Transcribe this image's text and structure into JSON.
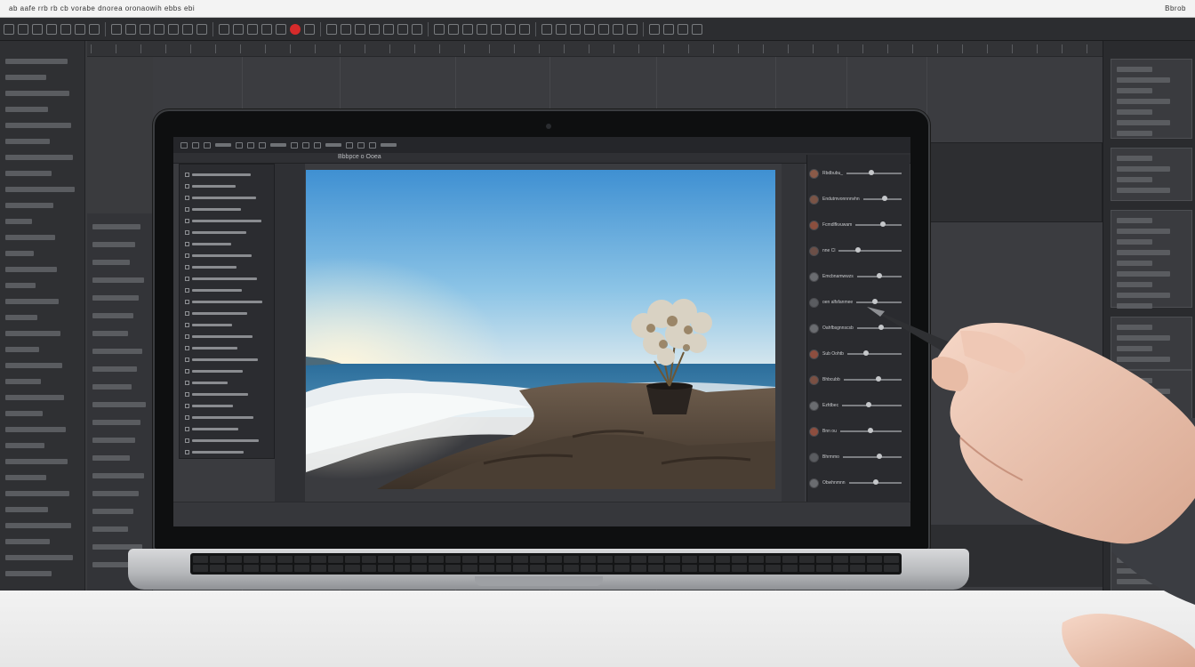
{
  "background_app": {
    "menubar_text": "ab aafe rrb rb cb vorabe dnorea oronaowih ebbs ebi",
    "menubar_right": "Bbrob",
    "tool_count": 52
  },
  "laptop_app": {
    "tab_label": "Bbbpce o Ooea",
    "photo_caption": "",
    "adjustment_rows": [
      {
        "label": "Rbdbubu_",
        "value": 0.45,
        "color": "#8a5a48"
      },
      {
        "label": "Endutmvonnnnvhn",
        "value": 0.55,
        "color": "#7a5446"
      },
      {
        "label": "Fcmdlfkvuwam",
        "value": 0.6,
        "color": "#8b4f3e"
      },
      {
        "label": "nne Cl",
        "value": 0.3,
        "color": "#6b4f47"
      },
      {
        "label": "Emcbnamwwzs",
        "value": 0.5,
        "color": "#6a6c70"
      },
      {
        "label": "oen alfsfanmee",
        "value": 0.4,
        "color": "#5a5c60"
      },
      {
        "label": "Oahfbsgnnscsb",
        "value": 0.55,
        "color": "#6a6c70"
      },
      {
        "label": "Sub Oohtb",
        "value": 0.35,
        "color": "#8d4e3f"
      },
      {
        "label": "Bhbcubb",
        "value": 0.6,
        "color": "#7a5043"
      },
      {
        "label": "Ezfdbec",
        "value": 0.45,
        "color": "#6a6c70"
      },
      {
        "label": "Bnn ou",
        "value": 0.5,
        "color": "#8d4e3f"
      },
      {
        "label": "Bhrmmo",
        "value": 0.62,
        "color": "#5a5c60"
      },
      {
        "label": "Obwhnmnn",
        "value": 0.52,
        "color": "#6a6c70"
      }
    ]
  },
  "colors": {
    "ui_dark": "#2b2c30",
    "record": "#d62b2b",
    "sky_top": "#4a98d6",
    "sea": "#2f6f9c"
  }
}
